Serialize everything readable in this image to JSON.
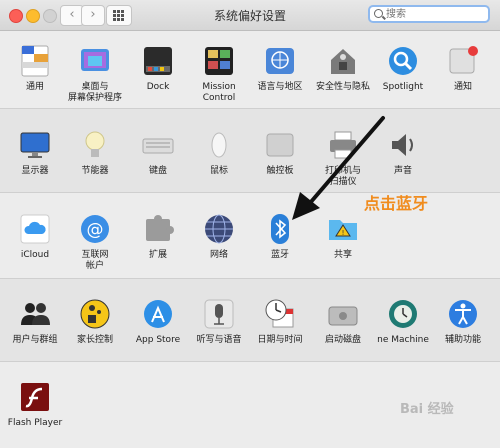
{
  "window": {
    "title": "系统偏好设置"
  },
  "search": {
    "placeholder": "搜索"
  },
  "rows": [
    [
      {
        "id": "general",
        "label": "通用"
      },
      {
        "id": "desktop",
        "label": "桌面与\n屏幕保护程序"
      },
      {
        "id": "dock",
        "label": "Dock"
      },
      {
        "id": "mission",
        "label": "Mission\nControl"
      },
      {
        "id": "language",
        "label": "语言与地区"
      },
      {
        "id": "security",
        "label": "安全性与隐私"
      },
      {
        "id": "spotlight",
        "label": "Spotlight"
      },
      {
        "id": "notifications",
        "label": "通知"
      }
    ],
    [
      {
        "id": "displays",
        "label": "显示器"
      },
      {
        "id": "energy",
        "label": "节能器"
      },
      {
        "id": "keyboard",
        "label": "键盘"
      },
      {
        "id": "mouse",
        "label": "鼠标"
      },
      {
        "id": "trackpad",
        "label": "触控板"
      },
      {
        "id": "printers",
        "label": "打印机与\n扫描仪"
      },
      {
        "id": "sound",
        "label": "声音"
      }
    ],
    [
      {
        "id": "icloud",
        "label": "iCloud"
      },
      {
        "id": "internet",
        "label": "互联网\n帐户"
      },
      {
        "id": "extensions",
        "label": "扩展"
      },
      {
        "id": "network",
        "label": "网络"
      },
      {
        "id": "bluetooth",
        "label": "蓝牙"
      },
      {
        "id": "sharing",
        "label": "共享"
      }
    ],
    [
      {
        "id": "users",
        "label": "用户与群组"
      },
      {
        "id": "parental",
        "label": "家长控制"
      },
      {
        "id": "appstore",
        "label": "App Store"
      },
      {
        "id": "dictation",
        "label": "听写与语音"
      },
      {
        "id": "datetime",
        "label": "日期与时间"
      },
      {
        "id": "startup",
        "label": "启动磁盘"
      },
      {
        "id": "timemachine",
        "label": "ne Machine"
      },
      {
        "id": "accessibility",
        "label": "辅助功能"
      }
    ],
    [
      {
        "id": "flash",
        "label": "Flash Player"
      }
    ]
  ],
  "annotation": "点击蓝牙",
  "watermark": "Bai 经验",
  "colors": {
    "annotation": "#f08c1e",
    "search_focus": "#8fb9ee"
  }
}
